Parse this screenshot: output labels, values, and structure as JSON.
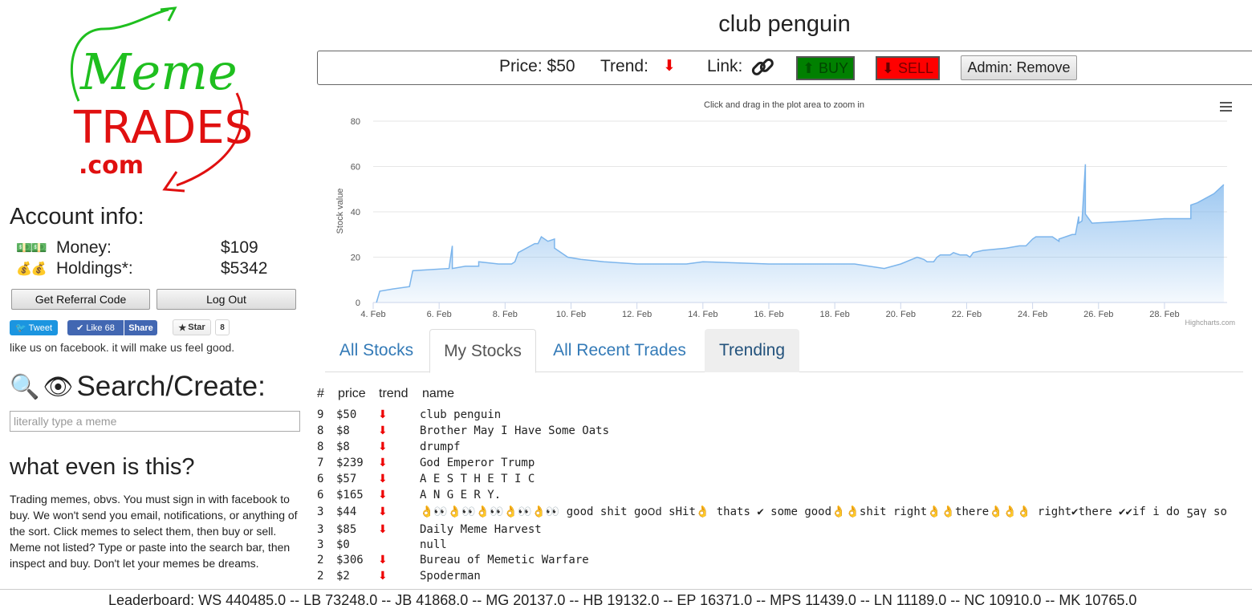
{
  "account": {
    "title": "Account info:",
    "money_label": "Money:",
    "money_value": "$109",
    "holdings_label": "Holdings*:",
    "holdings_value": "$5342",
    "referral_button": "Get Referral Code",
    "logout_button": "Log Out"
  },
  "social": {
    "tweet": "Tweet",
    "like": "Like 68",
    "share": "Share",
    "star": "Star",
    "star_count": "8",
    "facebook_note": "like us on facebook. it will make us feel good."
  },
  "search": {
    "title": "Search/Create:",
    "placeholder": "literally type a meme"
  },
  "about": {
    "title": "what even is this?",
    "body": "Trading memes, obvs. You must sign in with facebook to buy. We won't send you email, notifications, or anything of the sort. Click memes to select them, then buy or sell. Meme not listed? Type or paste into the search bar, then inspect and buy. Don't let your memes be dreams."
  },
  "stock": {
    "name": "club penguin",
    "price_label": "Price: $50",
    "trend_label": "Trend:",
    "link_label": "Link:",
    "buy_label": "BUY",
    "sell_label": "SELL",
    "admin_label": "Admin: Remove"
  },
  "tabs": [
    "All Stocks",
    "My Stocks",
    "All Recent Trades",
    "Trending"
  ],
  "table": {
    "headers": [
      "#",
      "price",
      "trend",
      "name"
    ],
    "rows": [
      {
        "n": "9",
        "price": "$50",
        "trend": "down",
        "name": "club penguin"
      },
      {
        "n": "8",
        "price": "$8",
        "trend": "down",
        "name": "Brother May I Have Some Oats"
      },
      {
        "n": "8",
        "price": "$8",
        "trend": "down",
        "name": "drumpf"
      },
      {
        "n": "7",
        "price": "$239",
        "trend": "down",
        "name": "God Emperor Trump"
      },
      {
        "n": "6",
        "price": "$57",
        "trend": "down",
        "name": "A E S T H E T I C"
      },
      {
        "n": "6",
        "price": "$165",
        "trend": "down",
        "name": "A N G E R Y."
      },
      {
        "n": "3",
        "price": "$44",
        "trend": "down",
        "name": "👌👀👌👀👌👀👌👀👌👀 good shit go౦ԁ sHit👌 thats ✔ some good👌👌shit right👌👌there👌👌👌 right✔there ✔✔if i do ƽaү so"
      },
      {
        "n": "3",
        "price": "$85",
        "trend": "down",
        "name": "Daily Meme Harvest"
      },
      {
        "n": "3",
        "price": "$0",
        "trend": "",
        "name": "null"
      },
      {
        "n": "2",
        "price": "$306",
        "trend": "down",
        "name": "Bureau of Memetic Warfare"
      },
      {
        "n": "2",
        "price": "$2",
        "trend": "down",
        "name": "Spoderman"
      }
    ]
  },
  "leaderboard": "Leaderboard: WS 440485.0 -- LB 73248.0 -- JB 41868.0 -- MG 20137.0 -- HB 19132.0 -- EP 16371.0 -- MPS 11439.0 -- LN 11189.0 -- NC 10910.0 -- MK 10765.0",
  "chart_data": {
    "type": "area",
    "subtitle": "Click and drag in the plot area to zoom in",
    "ylabel": "Stock value",
    "credits": "Highcharts.com",
    "ylim": [
      0,
      80
    ],
    "yticks": [
      0,
      20,
      40,
      60,
      80
    ],
    "xticks": [
      "4. Feb",
      "6. Feb",
      "8. Feb",
      "10. Feb",
      "12. Feb",
      "14. Feb",
      "16. Feb",
      "18. Feb",
      "20. Feb",
      "22. Feb",
      "24. Feb",
      "26. Feb",
      "28. Feb"
    ],
    "xlim_days": [
      4,
      29.9
    ],
    "color": "#7cb5ec",
    "series": [
      {
        "x": [
          4.1,
          4.2,
          4.6,
          5.1,
          5.2,
          5.2,
          6.3,
          6.4,
          6.4,
          6.8,
          7.2,
          7.2,
          7.8,
          8.1,
          8.2,
          8.3,
          8.4,
          8.9,
          9.0,
          9.1,
          9.3,
          9.5,
          9.5,
          9.9,
          10.3,
          11.0,
          12.0,
          13.5,
          14.0,
          16.0,
          18.0,
          18.6,
          19.5,
          20.0,
          20.5,
          20.7,
          20.8,
          21.0,
          21.1,
          21.2,
          21.5,
          21.6,
          21.8,
          22.0,
          22.1,
          22.2,
          22.5,
          23.2,
          23.6,
          23.8,
          24.0,
          24.1,
          24.6,
          24.8,
          24.8,
          25.2,
          25.3,
          25.4,
          25.4,
          25.5,
          25.6,
          25.6,
          25.8,
          27.0,
          28.0,
          28.8,
          28.8,
          29.0,
          29.5,
          29.8
        ],
        "y": [
          0,
          5,
          6,
          7,
          14,
          14,
          15,
          25,
          15,
          16,
          16,
          18,
          17,
          17,
          17,
          18,
          22,
          26,
          26,
          29,
          27,
          28,
          24,
          20,
          19,
          18,
          17,
          17,
          18,
          17,
          17,
          17,
          15,
          17,
          20,
          19,
          18,
          18,
          20,
          21,
          21,
          22,
          21,
          21,
          20,
          22,
          23,
          24,
          25,
          25,
          28,
          29,
          29,
          27,
          28,
          30,
          30,
          38,
          35,
          36,
          61,
          39,
          35,
          36,
          37,
          37,
          43,
          44,
          48,
          52
        ]
      }
    ]
  }
}
